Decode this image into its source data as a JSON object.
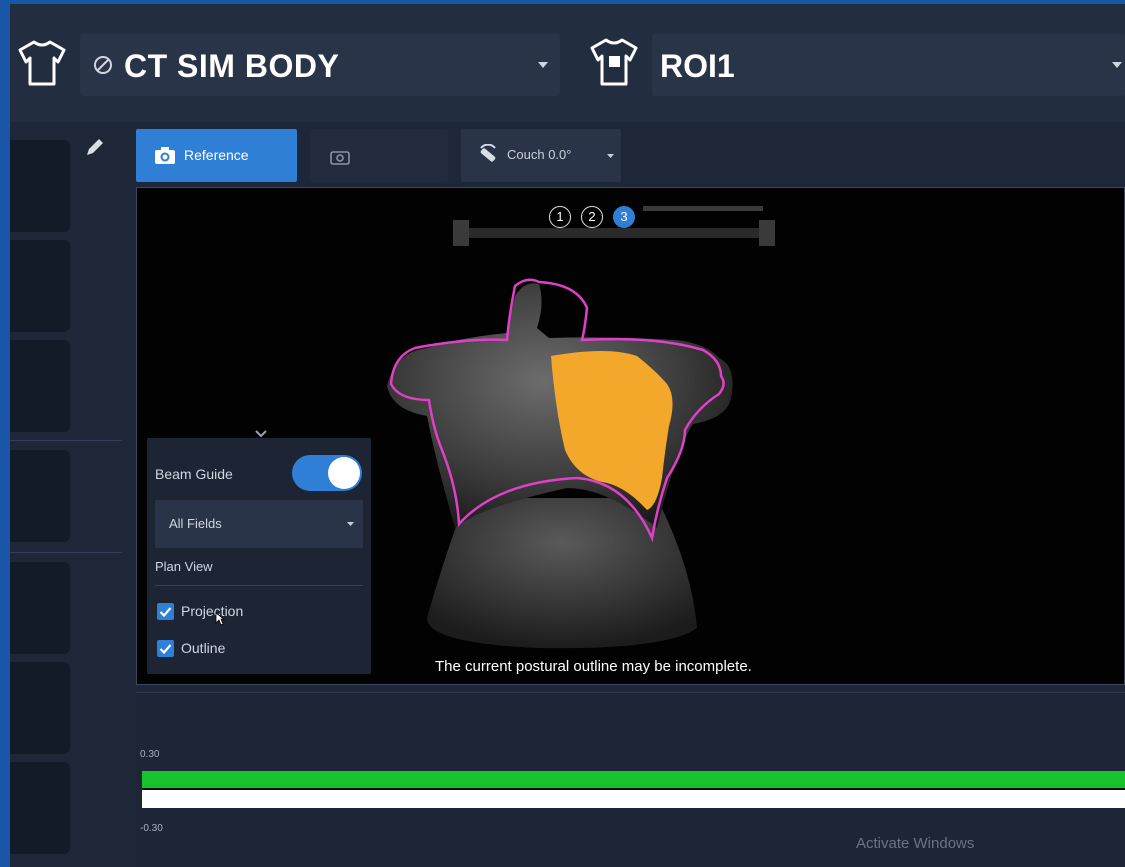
{
  "header": {
    "body_selector": {
      "label": "CT SIM BODY",
      "status_icon": "block-icon"
    },
    "roi_selector": {
      "label": "ROI1"
    }
  },
  "toolbar": {
    "reference_label": "Reference",
    "couch_label": "Couch 0.0°"
  },
  "viewport": {
    "steps": [
      "1",
      "2",
      "3"
    ],
    "active_step": "3",
    "message": "The current postural outline may be incomplete.",
    "colors": {
      "outline": "#e040c8",
      "projection": "#f3a82c"
    }
  },
  "beam_panel": {
    "beam_guide_label": "Beam Guide",
    "beam_guide_on": true,
    "fields_value": "All Fields",
    "plan_view_label": "Plan View",
    "options": [
      {
        "label": "Projection",
        "checked": true
      },
      {
        "label": "Outline",
        "checked": true
      }
    ]
  },
  "chart": {
    "upper_label": "0.30",
    "lower_label": "-0.30",
    "colors": {
      "band_upper": "#17c32d",
      "band_lower": "#ffffff"
    }
  },
  "watermark": "Activate Windows"
}
